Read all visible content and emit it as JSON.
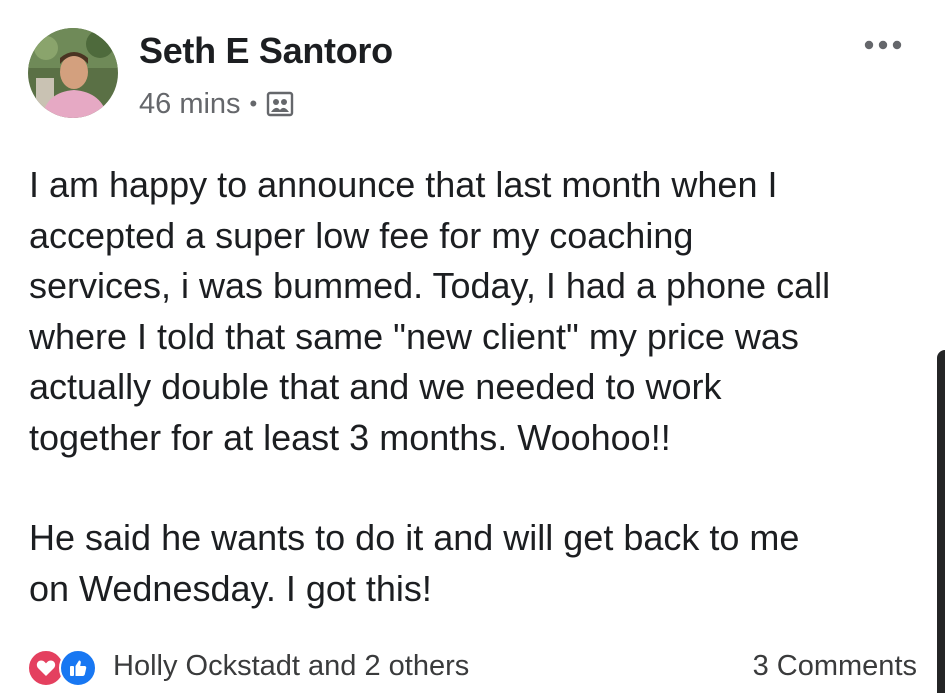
{
  "post": {
    "author": "Seth E Santoro",
    "timestamp": "46 mins",
    "separator": "•",
    "audience_icon": "friends-group-icon",
    "paragraphs": [
      "I am happy to announce that last month when I\naccepted a super low fee for my coaching\nservices, i was bummed. Today, I had a phone call\nwhere I told that same \"new client\" my price was\nactually double that and we needed to work\ntogether for at least 3 months. Woohoo!!",
      "He said he wants to do it and will get back to me\non Wednesday. I got this!"
    ]
  },
  "reactions": {
    "icons": [
      "love-icon",
      "like-icon"
    ],
    "summary": "Holly Ockstadt and 2 others",
    "comments": "3 Comments"
  },
  "colors": {
    "text": "#1c1e21",
    "meta": "#65676b",
    "love": "#e4405f",
    "like": "#1877f2"
  }
}
